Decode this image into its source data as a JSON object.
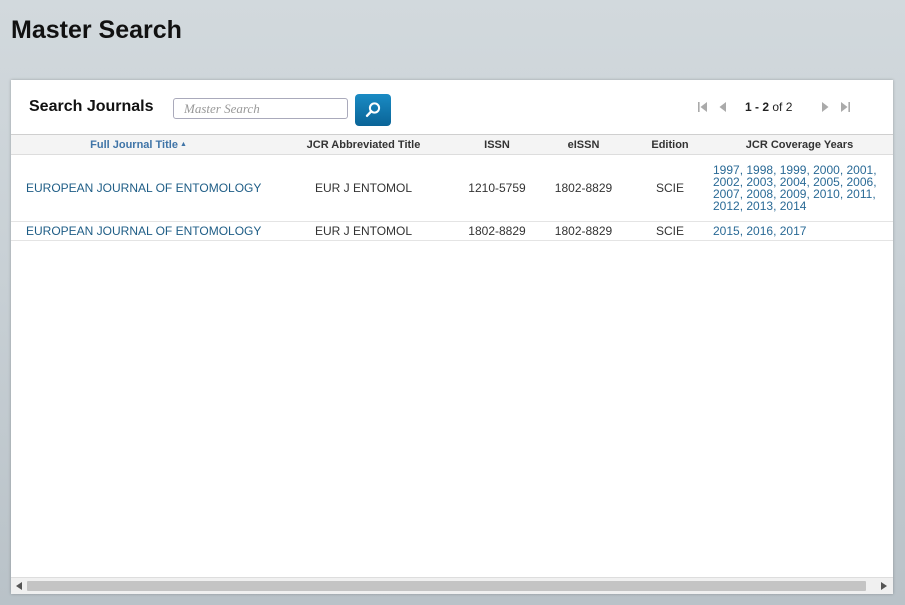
{
  "page": {
    "title": "Master Search"
  },
  "search": {
    "label": "Search Journals",
    "placeholder": "Master Search",
    "value": ""
  },
  "pager": {
    "range": "1 - 2",
    "of_label": "of",
    "total_pages": "2"
  },
  "table": {
    "columns": [
      "Full Journal Title",
      "JCR Abbreviated Title",
      "ISSN",
      "eISSN",
      "Edition",
      "JCR Coverage Years"
    ],
    "sorted_column": "Full Journal Title",
    "sort_direction": "ascending",
    "rows": [
      {
        "full_title": "EUROPEAN JOURNAL OF ENTOMOLOGY",
        "abbr_title": "EUR J ENTOMOL",
        "issn": "1210-5759",
        "eissn": "1802-8829",
        "edition": "SCIE",
        "years": [
          "1997",
          "1998",
          "1999",
          "2000",
          "2001",
          "2002",
          "2003",
          "2004",
          "2005",
          "2006",
          "2007",
          "2008",
          "2009",
          "2010",
          "2011",
          "2012",
          "2013",
          "2014"
        ]
      },
      {
        "full_title": "EUROPEAN JOURNAL OF ENTOMOLOGY",
        "abbr_title": "EUR J ENTOMOL",
        "issn": "1802-8829",
        "eissn": "1802-8829",
        "edition": "SCIE",
        "years": [
          "2015",
          "2016",
          "2017"
        ]
      }
    ]
  },
  "colors": {
    "link": "#1e5d86",
    "sorted_header": "#3f74a7",
    "search_button": "#0a6497"
  },
  "icons": {
    "search_button": "magnifier-icon",
    "pager": [
      "first-page-icon",
      "prev-page-icon",
      "next-page-icon",
      "last-page-icon"
    ],
    "scrollbar": [
      "scroll-left-icon",
      "scroll-right-icon"
    ]
  }
}
